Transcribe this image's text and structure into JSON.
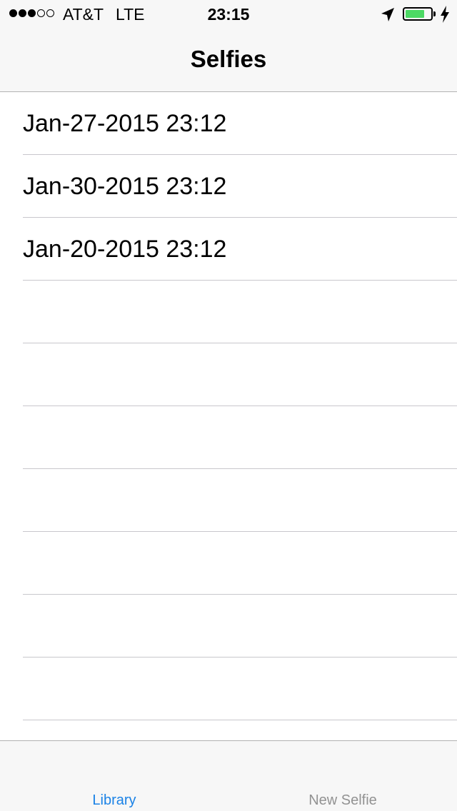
{
  "status_bar": {
    "signal_bars_total": 5,
    "signal_bars_filled": 3,
    "carrier": "AT&T",
    "network": "LTE",
    "time": "23:15",
    "battery_fraction": 0.75,
    "battery_color": "#4cd964",
    "icons": [
      "location-arrow-icon",
      "battery-icon",
      "charging-bolt-icon"
    ]
  },
  "nav": {
    "title": "Selfies"
  },
  "list": {
    "items": [
      {
        "label": "Jan-27-2015 23:12"
      },
      {
        "label": "Jan-30-2015 23:12"
      },
      {
        "label": "Jan-20-2015 23:12"
      },
      {
        "label": ""
      },
      {
        "label": ""
      },
      {
        "label": ""
      },
      {
        "label": ""
      },
      {
        "label": ""
      },
      {
        "label": ""
      },
      {
        "label": ""
      }
    ]
  },
  "tab_bar": {
    "accent_color": "#1a82e6",
    "tabs": [
      {
        "label": "Library",
        "active": true
      },
      {
        "label": "New Selfie",
        "active": false
      }
    ]
  }
}
